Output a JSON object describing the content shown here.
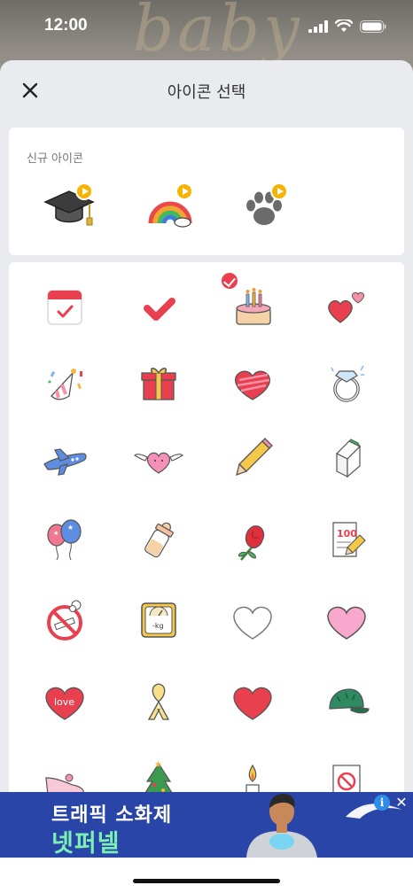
{
  "status": {
    "time": "12:00"
  },
  "backdrop": {
    "text": "baby"
  },
  "header": {
    "title": "아이콘 선택",
    "close_icon": "close-icon"
  },
  "new_section": {
    "label": "신규 아이콘",
    "icons": [
      "graduation-cap-icon",
      "rainbow-icon",
      "paw-print-icon"
    ]
  },
  "grid": {
    "selected": "calendar-icon",
    "rows": [
      [
        "calendar-icon",
        "check-icon",
        "birthday-cake-icon",
        "hearts-icon"
      ],
      [
        "party-hat-icon",
        "gift-box-icon",
        "striped-heart-icon",
        "diamond-ring-icon"
      ],
      [
        "airplane-icon",
        "winged-heart-icon",
        "pencil-icon",
        "milk-carton-icon"
      ],
      [
        "balloons-icon",
        "baby-bottle-icon",
        "rose-icon",
        "score-paper-icon"
      ],
      [
        "no-smoking-icon",
        "scale-icon",
        "white-heart-icon",
        "pink-heart-icon"
      ],
      [
        "love-heart-icon",
        "ribbon-icon",
        "red-heart-icon",
        "cap-icon"
      ],
      [
        "shoe-icon",
        "christmas-tree-icon",
        "candle-icon",
        "no-sign-paper-icon"
      ]
    ],
    "scale_label": "-kg",
    "score_label": "100",
    "love_label": "love"
  },
  "ad": {
    "line1": "트래픽 소화제",
    "line2": "넷퍼넬",
    "info_label": "i",
    "close_label": "✕"
  },
  "colors": {
    "accent": "#e8404e",
    "play_badge": "#f6b400",
    "ad_bg": "#2a45a8",
    "ad_text2": "#7cf0b4"
  }
}
